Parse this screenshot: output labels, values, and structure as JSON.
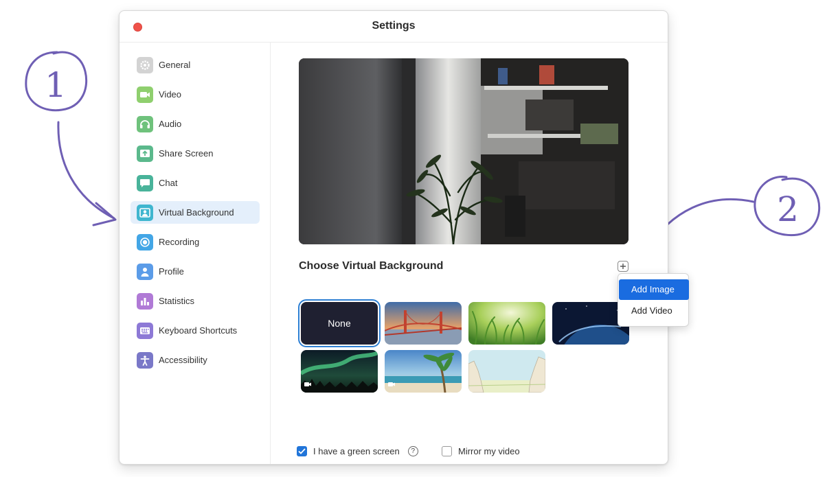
{
  "window": {
    "title": "Settings"
  },
  "sidebar": {
    "items": [
      {
        "label": "General",
        "icon": "gear-icon",
        "color": "#cfcfcf"
      },
      {
        "label": "Video",
        "icon": "video-camera-icon",
        "color": "#8fcf6e"
      },
      {
        "label": "Audio",
        "icon": "headphones-icon",
        "color": "#6fc27c"
      },
      {
        "label": "Share Screen",
        "icon": "share-screen-icon",
        "color": "#5bb98c"
      },
      {
        "label": "Chat",
        "icon": "chat-bubble-icon",
        "color": "#49b39a"
      },
      {
        "label": "Virtual Background",
        "icon": "person-portrait-icon",
        "color": "#3fb6cf",
        "active": true
      },
      {
        "label": "Recording",
        "icon": "record-icon",
        "color": "#43a6e6"
      },
      {
        "label": "Profile",
        "icon": "user-icon",
        "color": "#5b9ce8"
      },
      {
        "label": "Statistics",
        "icon": "bar-chart-icon",
        "color": "#b07ad6"
      },
      {
        "label": "Keyboard Shortcuts",
        "icon": "keyboard-icon",
        "color": "#8d79d6"
      },
      {
        "label": "Accessibility",
        "icon": "accessibility-icon",
        "color": "#7a78c8"
      }
    ]
  },
  "main": {
    "section_title": "Choose Virtual Background",
    "backgrounds": [
      {
        "label": "None",
        "kind": "none",
        "selected": true
      },
      {
        "kind": "image",
        "name": "golden-gate-bridge"
      },
      {
        "kind": "image",
        "name": "grass"
      },
      {
        "kind": "image",
        "name": "earth-from-space"
      },
      {
        "kind": "video",
        "name": "northern-lights"
      },
      {
        "kind": "video",
        "name": "beach"
      },
      {
        "kind": "image",
        "name": "cartoon-landscape"
      }
    ],
    "add_menu": {
      "items": [
        "Add Image",
        "Add Video"
      ],
      "highlighted": "Add Image"
    },
    "green_screen": {
      "label": "I have a green screen",
      "checked": true
    },
    "mirror": {
      "label": "Mirror my video",
      "checked": false
    }
  },
  "annotations": {
    "step1": "1",
    "step2": "2",
    "color": "#6f5fb4"
  }
}
